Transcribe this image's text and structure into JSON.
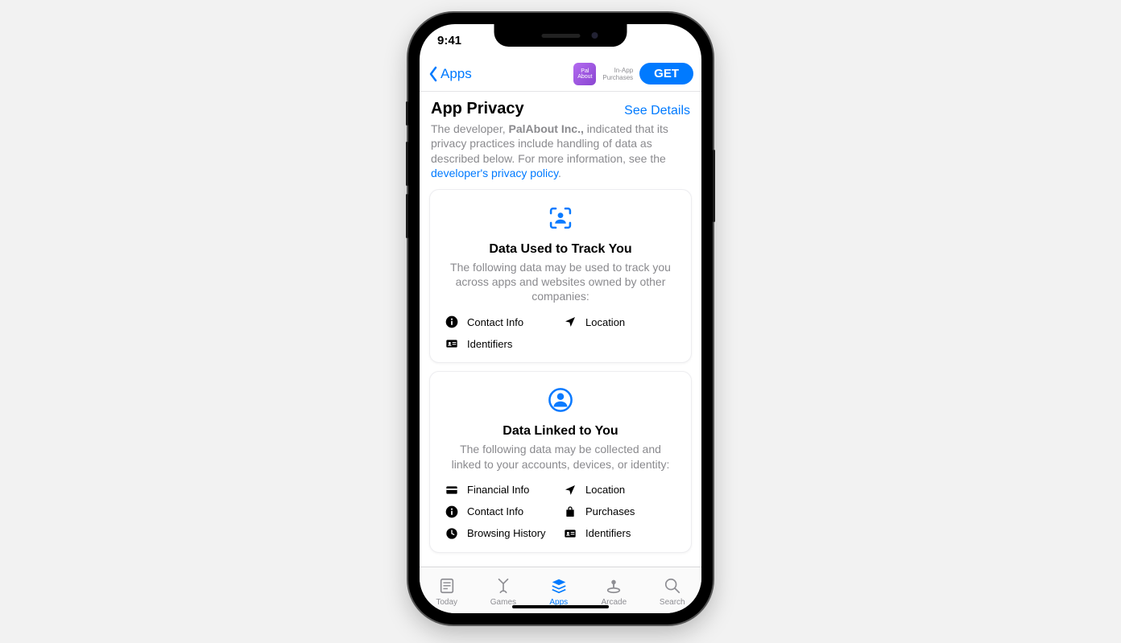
{
  "status": {
    "time": "9:41"
  },
  "nav": {
    "back_label": "Apps",
    "app_icon": {
      "line1": "Pal",
      "line2": "About"
    },
    "iap_line1": "In-App",
    "iap_line2": "Purchases",
    "get_label": "GET"
  },
  "privacy": {
    "title": "App Privacy",
    "see_details": "See Details",
    "desc_prefix": "The developer, ",
    "developer": "PalAbout Inc.,",
    "desc_middle": " indicated that its privacy practices include handling of data as described below. For more information, see the ",
    "desc_link": "developer's privacy policy",
    "desc_suffix": "."
  },
  "cards": [
    {
      "icon": "tracking",
      "title": "Data Used to Track You",
      "desc": "The following data may be used to track you across apps and websites owned by other companies:",
      "items": [
        {
          "icon": "info",
          "label": "Contact Info"
        },
        {
          "icon": "location",
          "label": "Location"
        },
        {
          "icon": "id",
          "label": "Identifiers"
        }
      ]
    },
    {
      "icon": "linked",
      "title": "Data Linked to You",
      "desc": "The following data may be collected and linked to your accounts, devices, or identity:",
      "items": [
        {
          "icon": "financial",
          "label": "Financial Info"
        },
        {
          "icon": "location",
          "label": "Location"
        },
        {
          "icon": "info",
          "label": "Contact Info"
        },
        {
          "icon": "purchases",
          "label": "Purchases"
        },
        {
          "icon": "history",
          "label": "Browsing History"
        },
        {
          "icon": "id",
          "label": "Identifiers"
        }
      ]
    }
  ],
  "tabs": [
    {
      "icon": "today",
      "label": "Today"
    },
    {
      "icon": "games",
      "label": "Games"
    },
    {
      "icon": "apps",
      "label": "Apps",
      "active": true
    },
    {
      "icon": "arcade",
      "label": "Arcade"
    },
    {
      "icon": "search",
      "label": "Search"
    }
  ]
}
